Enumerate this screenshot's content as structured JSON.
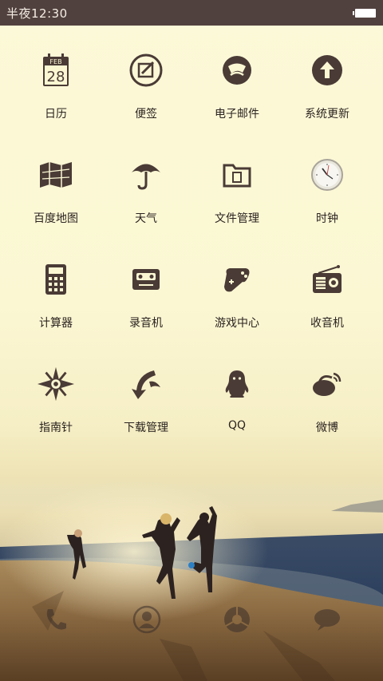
{
  "status_bar": {
    "time": "半夜12:30"
  },
  "apps": [
    {
      "label": "日历",
      "icon": "calendar-icon",
      "calendar_month": "FEB",
      "calendar_day": "28"
    },
    {
      "label": "便签",
      "icon": "notes-icon"
    },
    {
      "label": "电子邮件",
      "icon": "email-icon"
    },
    {
      "label": "系统更新",
      "icon": "system-update-icon"
    },
    {
      "label": "百度地图",
      "icon": "map-icon"
    },
    {
      "label": "天气",
      "icon": "umbrella-icon"
    },
    {
      "label": "文件管理",
      "icon": "folder-icon"
    },
    {
      "label": "时钟",
      "icon": "clock-icon"
    },
    {
      "label": "计算器",
      "icon": "calculator-icon"
    },
    {
      "label": "录音机",
      "icon": "cassette-icon"
    },
    {
      "label": "游戏中心",
      "icon": "gamepad-icon"
    },
    {
      "label": "收音机",
      "icon": "radio-icon"
    },
    {
      "label": "指南针",
      "icon": "compass-icon"
    },
    {
      "label": "下载管理",
      "icon": "download-icon"
    },
    {
      "label": "QQ",
      "icon": "qq-penguin-icon"
    },
    {
      "label": "微博",
      "icon": "weibo-icon"
    }
  ],
  "dock": [
    {
      "icon": "phone-icon"
    },
    {
      "icon": "contacts-icon"
    },
    {
      "icon": "browser-icon"
    },
    {
      "icon": "messages-icon"
    }
  ],
  "colors": {
    "status_bar": "#51413e",
    "icon": "#4a3b36",
    "label": "#2b2320"
  }
}
